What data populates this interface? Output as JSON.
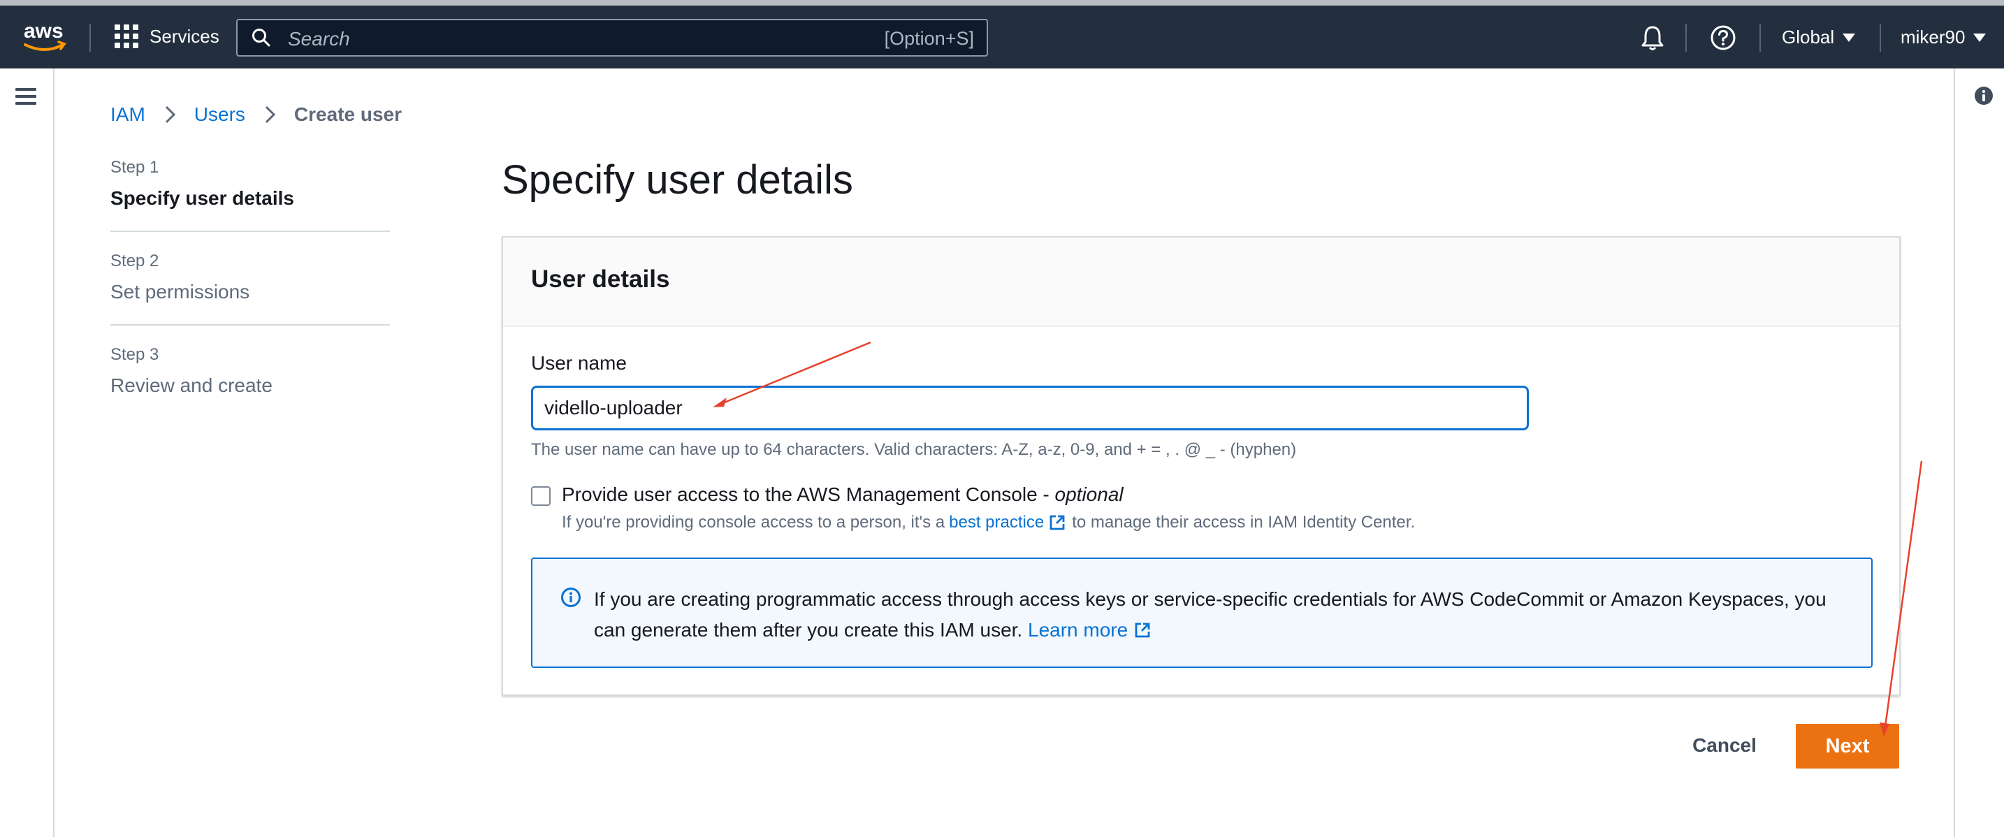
{
  "nav": {
    "services_label": "Services",
    "search_placeholder": "Search",
    "search_shortcut": "[Option+S]",
    "region_label": "Global",
    "user_label": "miker90"
  },
  "breadcrumb": {
    "items": [
      "IAM",
      "Users"
    ],
    "current": "Create user"
  },
  "steps": [
    {
      "number": "Step 1",
      "title": "Specify user details",
      "active": true
    },
    {
      "number": "Step 2",
      "title": "Set permissions"
    },
    {
      "number": "Step 3",
      "title": "Review and create"
    }
  ],
  "page_title": "Specify user details",
  "user_details": {
    "title": "User details",
    "field_label": "User name",
    "username_value": "vidello-uploader",
    "constraint_text": "The user name can have up to 64 characters. Valid characters: A-Z, a-z, 0-9, and + = , . @ _ - (hyphen)",
    "console_access_label": "Provide user access to the AWS Management Console - ",
    "console_access_optional": "optional",
    "console_desc_prefix": "If you're providing console access to a person, it's a",
    "console_desc_link": "best practice",
    "console_desc_suffix": "to manage their access in IAM Identity Center."
  },
  "info_alert": {
    "text": "If you are creating programmatic access through access keys or service-specific credentials for AWS CodeCommit or Amazon Keyspaces, you can generate them after you create this IAM user. ",
    "link": "Learn more"
  },
  "actions": {
    "cancel_label": "Cancel",
    "next_label": "Next"
  },
  "colors": {
    "nav_bg": "#232f3e",
    "link": "#0972d3",
    "primary_button": "#ec7211",
    "annotation_arrow": "#e8412c"
  }
}
